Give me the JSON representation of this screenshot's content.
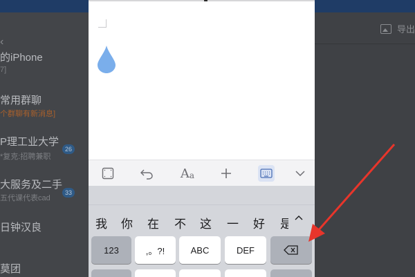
{
  "background_list": {
    "items": [
      {
        "title": "的iPhone",
        "subtitle": "7]"
      },
      {
        "title": "常用群聊",
        "subtitle": "个群聊有新消息]",
        "subtitle_alert": true
      },
      {
        "title": "P理工业大学",
        "subtitle": "*复克:招聘兼职",
        "unread": "26"
      },
      {
        "title": "大服务及二手",
        "subtitle": "五代课代表cad",
        "unread": "33"
      },
      {
        "title": "日钟汉良",
        "subtitle": ""
      },
      {
        "title": "莫团",
        "subtitle": ""
      }
    ],
    "export_label": "导出"
  },
  "editor": {
    "drop_color": "#7aaeeb"
  },
  "toolbar": {
    "icons": [
      "fullscreen-icon",
      "undo-icon",
      "text-format-icon",
      "insert-icon",
      "keyboard-icon",
      "collapse-icon"
    ],
    "active_color": "#dbe3f4"
  },
  "keyboard": {
    "candidates": [
      "我",
      "你",
      "在",
      "不",
      "这",
      "一",
      "好",
      "是"
    ],
    "keys": {
      "numbers": "123",
      "punct": ",。?!",
      "abc": "ABC",
      "def": "DEF"
    }
  },
  "annotation": {
    "arrow_color": "#e8352b"
  }
}
